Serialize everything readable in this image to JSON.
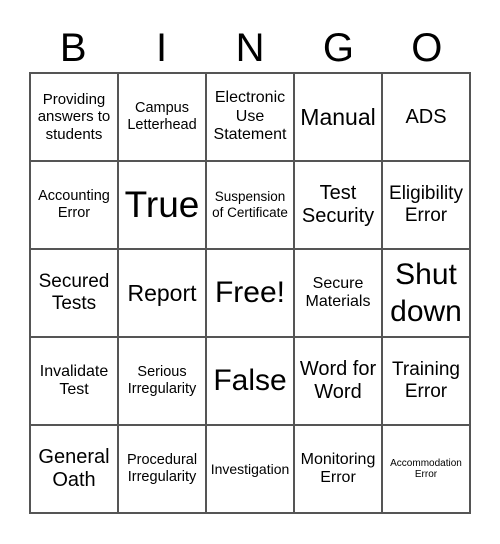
{
  "header": [
    "B",
    "I",
    "N",
    "G",
    "O"
  ],
  "cells": [
    "Providing answers to students",
    "Campus Letterhead",
    "Electronic Use Statement",
    "Manual",
    "ADS",
    "Accounting Error",
    "True",
    "Suspension of Certificate",
    "Test Security",
    "Eligibility Error",
    "Secured Tests",
    "Report",
    "Free!",
    "Secure Materials",
    "Shut down",
    "Invalidate Test",
    "Serious Irregularity",
    "False",
    "Word for Word",
    "Training Error",
    "General Oath",
    "Procedural Irregularity",
    "Investigation",
    "Monitoring Error",
    "Accommodation Error"
  ]
}
